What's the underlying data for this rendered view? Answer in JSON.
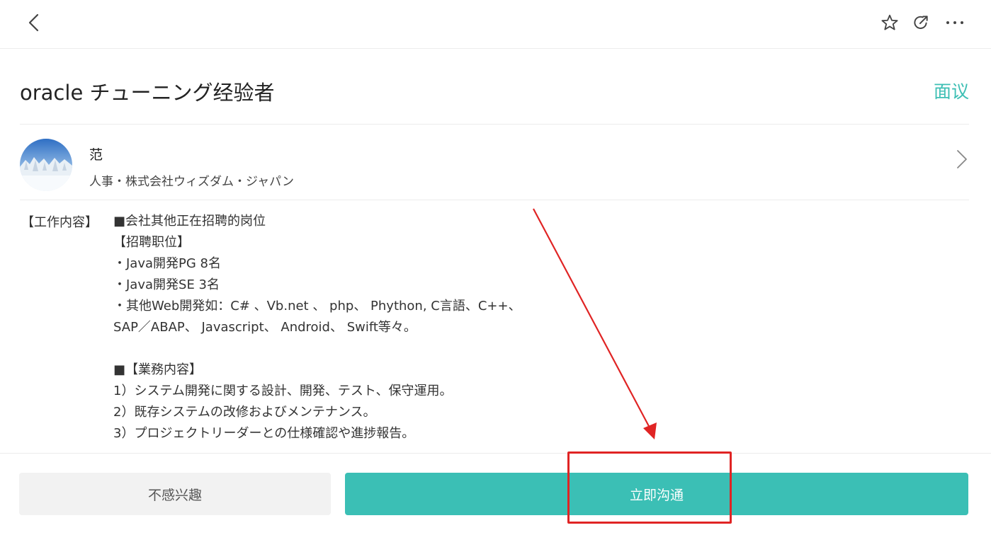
{
  "header": {
    "back_icon": "chevron-left-icon",
    "actions": [
      "star-icon",
      "share-icon",
      "more-icon"
    ]
  },
  "job": {
    "title": "oracle チューニング经验者",
    "salary": "面议"
  },
  "recruiter": {
    "name": "范",
    "company": "人事・株式会社ウィズダム・ジャパン"
  },
  "description": {
    "label": "【工作内容】",
    "lines": [
      "■会社其他正在招聘的岗位",
      "【招聘职位】",
      "・Java開発PG 8名",
      "・Java開発SE 3名",
      "・其他Web開発如：C# 、Vb.net 、 php、 Phython, C言語、C++、",
      "SAP／ABAP、 Javascript、 Android、 Swift等々。",
      "",
      "■【業務内容】",
      "1）システム開発に関する設計、開発、テスト、保守運用。",
      "2）既存システムの改修およびメンテナンス。",
      "3）プロジェクトリーダーとの仕様確認や進捗報告。"
    ]
  },
  "actions": {
    "not_interested": "不感兴趣",
    "chat_now": "立即沟通"
  },
  "colors": {
    "accent": "#3bbfb5",
    "annotation": "#e02424"
  }
}
